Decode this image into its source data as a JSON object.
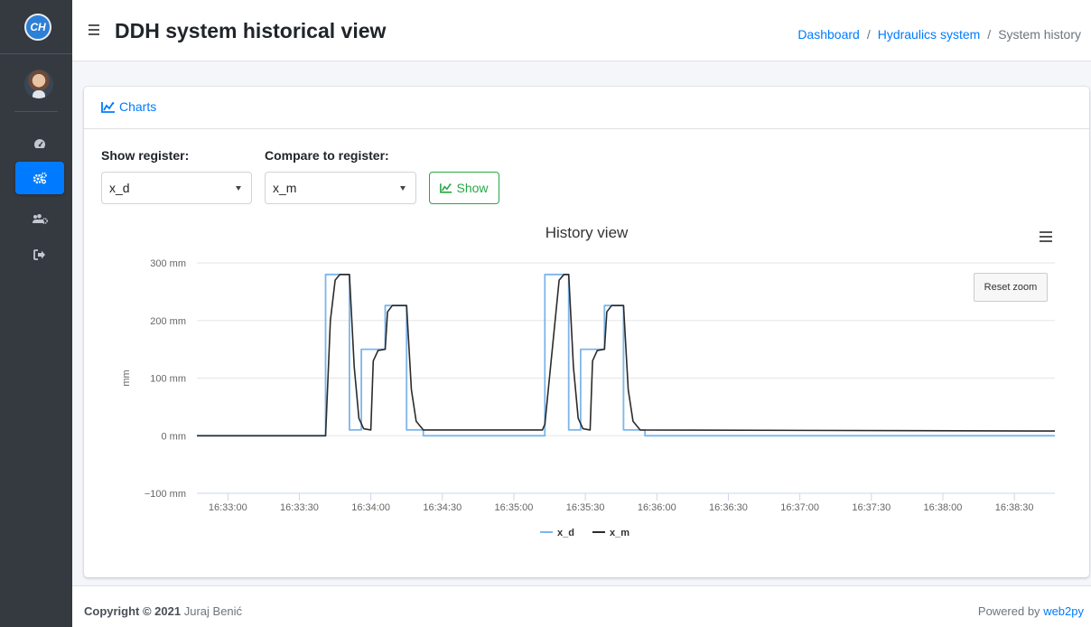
{
  "sidebar": {
    "brand_initials": "CH",
    "nav": [
      {
        "icon": "tachometer-icon",
        "active": false
      },
      {
        "icon": "cogs-icon",
        "active": true
      },
      {
        "icon": "users-cog-icon",
        "active": false
      },
      {
        "icon": "sign-out-icon",
        "active": false
      }
    ]
  },
  "header": {
    "title": "DDH system historical view",
    "breadcrumb": {
      "item1": "Dashboard",
      "item2": "Hydraulics system",
      "current": "System history",
      "separator": "/"
    }
  },
  "card": {
    "title": "Charts",
    "show_register_label": "Show register:",
    "show_register_value": "x_d",
    "compare_label": "Compare to register:",
    "compare_value": "x_m",
    "show_button": "Show",
    "reset_zoom": "Reset zoom"
  },
  "chart_data": {
    "type": "line",
    "title": "History view",
    "xlabel": "",
    "ylabel": "mm",
    "ylim": [
      -100,
      300
    ],
    "yticks": [
      -100,
      0,
      100,
      200,
      300
    ],
    "ytick_labels": [
      "−100 mm",
      "0 mm",
      "100 mm",
      "200 mm",
      "300 mm"
    ],
    "xtick_labels": [
      "16:33:00",
      "16:33:30",
      "16:34:00",
      "16:34:30",
      "16:35:00",
      "16:35:30",
      "16:36:00",
      "16:36:30",
      "16:37:00",
      "16:37:30",
      "16:38:00",
      "16:38:30"
    ],
    "x_range": [
      "16:32:47",
      "16:38:47"
    ],
    "legend": "bottom-center",
    "grid": true,
    "series": [
      {
        "name": "x_d",
        "color": "#7cb5ec",
        "points": [
          [
            "16:32:47",
            0
          ],
          [
            "16:33:41",
            0
          ],
          [
            "16:33:41",
            280
          ],
          [
            "16:33:51",
            280
          ],
          [
            "16:33:51",
            10
          ],
          [
            "16:33:56",
            10
          ],
          [
            "16:33:56",
            150
          ],
          [
            "16:34:06",
            150
          ],
          [
            "16:34:06",
            226
          ],
          [
            "16:34:15",
            226
          ],
          [
            "16:34:15",
            10
          ],
          [
            "16:34:22",
            10
          ],
          [
            "16:34:22",
            0
          ],
          [
            "16:35:13",
            0
          ],
          [
            "16:35:13",
            280
          ],
          [
            "16:35:23",
            280
          ],
          [
            "16:35:23",
            10
          ],
          [
            "16:35:28",
            10
          ],
          [
            "16:35:28",
            150
          ],
          [
            "16:35:38",
            150
          ],
          [
            "16:35:38",
            226
          ],
          [
            "16:35:46",
            226
          ],
          [
            "16:35:46",
            10
          ],
          [
            "16:35:55",
            10
          ],
          [
            "16:35:55",
            0
          ],
          [
            "16:38:47",
            0
          ]
        ]
      },
      {
        "name": "x_m",
        "color": "#2b2b2b",
        "points": [
          [
            "16:32:47",
            0
          ],
          [
            "16:33:41",
            0
          ],
          [
            "16:33:43",
            200
          ],
          [
            "16:33:45",
            270
          ],
          [
            "16:33:47",
            280
          ],
          [
            "16:33:51",
            280
          ],
          [
            "16:33:53",
            120
          ],
          [
            "16:33:55",
            30
          ],
          [
            "16:33:57",
            12
          ],
          [
            "16:34:00",
            10
          ],
          [
            "16:34:01",
            130
          ],
          [
            "16:34:03",
            148
          ],
          [
            "16:34:06",
            150
          ],
          [
            "16:34:07",
            215
          ],
          [
            "16:34:09",
            226
          ],
          [
            "16:34:15",
            226
          ],
          [
            "16:34:17",
            80
          ],
          [
            "16:34:19",
            25
          ],
          [
            "16:34:22",
            10
          ],
          [
            "16:35:12",
            10
          ],
          [
            "16:35:13",
            20
          ],
          [
            "16:35:19",
            270
          ],
          [
            "16:35:21",
            280
          ],
          [
            "16:35:23",
            280
          ],
          [
            "16:35:25",
            120
          ],
          [
            "16:35:27",
            30
          ],
          [
            "16:35:29",
            12
          ],
          [
            "16:35:32",
            10
          ],
          [
            "16:35:33",
            130
          ],
          [
            "16:35:35",
            148
          ],
          [
            "16:35:38",
            150
          ],
          [
            "16:35:39",
            215
          ],
          [
            "16:35:41",
            226
          ],
          [
            "16:35:46",
            226
          ],
          [
            "16:35:48",
            80
          ],
          [
            "16:35:50",
            25
          ],
          [
            "16:35:53",
            10
          ],
          [
            "16:38:47",
            8
          ]
        ]
      }
    ]
  },
  "footer": {
    "copyright_label": "Copyright © 2021",
    "author": "Juraj Benić",
    "powered_text": "Powered by",
    "powered_link": "web2py"
  }
}
